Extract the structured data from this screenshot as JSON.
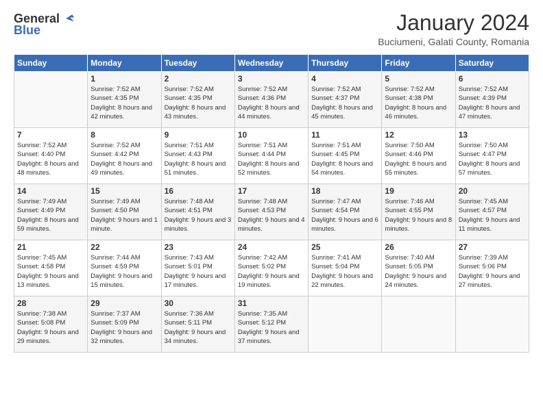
{
  "header": {
    "logo_general": "General",
    "logo_blue": "Blue",
    "month": "January 2024",
    "location": "Buciumeni, Galati County, Romania"
  },
  "weekdays": [
    "Sunday",
    "Monday",
    "Tuesday",
    "Wednesday",
    "Thursday",
    "Friday",
    "Saturday"
  ],
  "weeks": [
    [
      {
        "day": "",
        "sunrise": "",
        "sunset": "",
        "daylight": ""
      },
      {
        "day": "1",
        "sunrise": "Sunrise: 7:52 AM",
        "sunset": "Sunset: 4:35 PM",
        "daylight": "Daylight: 8 hours and 42 minutes."
      },
      {
        "day": "2",
        "sunrise": "Sunrise: 7:52 AM",
        "sunset": "Sunset: 4:35 PM",
        "daylight": "Daylight: 8 hours and 43 minutes."
      },
      {
        "day": "3",
        "sunrise": "Sunrise: 7:52 AM",
        "sunset": "Sunset: 4:36 PM",
        "daylight": "Daylight: 8 hours and 44 minutes."
      },
      {
        "day": "4",
        "sunrise": "Sunrise: 7:52 AM",
        "sunset": "Sunset: 4:37 PM",
        "daylight": "Daylight: 8 hours and 45 minutes."
      },
      {
        "day": "5",
        "sunrise": "Sunrise: 7:52 AM",
        "sunset": "Sunset: 4:38 PM",
        "daylight": "Daylight: 8 hours and 46 minutes."
      },
      {
        "day": "6",
        "sunrise": "Sunrise: 7:52 AM",
        "sunset": "Sunset: 4:39 PM",
        "daylight": "Daylight: 8 hours and 47 minutes."
      }
    ],
    [
      {
        "day": "7",
        "sunrise": "Sunrise: 7:52 AM",
        "sunset": "Sunset: 4:40 PM",
        "daylight": "Daylight: 8 hours and 48 minutes."
      },
      {
        "day": "8",
        "sunrise": "Sunrise: 7:52 AM",
        "sunset": "Sunset: 4:42 PM",
        "daylight": "Daylight: 8 hours and 49 minutes."
      },
      {
        "day": "9",
        "sunrise": "Sunrise: 7:51 AM",
        "sunset": "Sunset: 4:43 PM",
        "daylight": "Daylight: 8 hours and 51 minutes."
      },
      {
        "day": "10",
        "sunrise": "Sunrise: 7:51 AM",
        "sunset": "Sunset: 4:44 PM",
        "daylight": "Daylight: 8 hours and 52 minutes."
      },
      {
        "day": "11",
        "sunrise": "Sunrise: 7:51 AM",
        "sunset": "Sunset: 4:45 PM",
        "daylight": "Daylight: 8 hours and 54 minutes."
      },
      {
        "day": "12",
        "sunrise": "Sunrise: 7:50 AM",
        "sunset": "Sunset: 4:46 PM",
        "daylight": "Daylight: 8 hours and 55 minutes."
      },
      {
        "day": "13",
        "sunrise": "Sunrise: 7:50 AM",
        "sunset": "Sunset: 4:47 PM",
        "daylight": "Daylight: 8 hours and 57 minutes."
      }
    ],
    [
      {
        "day": "14",
        "sunrise": "Sunrise: 7:49 AM",
        "sunset": "Sunset: 4:49 PM",
        "daylight": "Daylight: 8 hours and 59 minutes."
      },
      {
        "day": "15",
        "sunrise": "Sunrise: 7:49 AM",
        "sunset": "Sunset: 4:50 PM",
        "daylight": "Daylight: 9 hours and 1 minute."
      },
      {
        "day": "16",
        "sunrise": "Sunrise: 7:48 AM",
        "sunset": "Sunset: 4:51 PM",
        "daylight": "Daylight: 9 hours and 3 minutes."
      },
      {
        "day": "17",
        "sunrise": "Sunrise: 7:48 AM",
        "sunset": "Sunset: 4:53 PM",
        "daylight": "Daylight: 9 hours and 4 minutes."
      },
      {
        "day": "18",
        "sunrise": "Sunrise: 7:47 AM",
        "sunset": "Sunset: 4:54 PM",
        "daylight": "Daylight: 9 hours and 6 minutes."
      },
      {
        "day": "19",
        "sunrise": "Sunrise: 7:46 AM",
        "sunset": "Sunset: 4:55 PM",
        "daylight": "Daylight: 9 hours and 8 minutes."
      },
      {
        "day": "20",
        "sunrise": "Sunrise: 7:45 AM",
        "sunset": "Sunset: 4:57 PM",
        "daylight": "Daylight: 9 hours and 11 minutes."
      }
    ],
    [
      {
        "day": "21",
        "sunrise": "Sunrise: 7:45 AM",
        "sunset": "Sunset: 4:58 PM",
        "daylight": "Daylight: 9 hours and 13 minutes."
      },
      {
        "day": "22",
        "sunrise": "Sunrise: 7:44 AM",
        "sunset": "Sunset: 4:59 PM",
        "daylight": "Daylight: 9 hours and 15 minutes."
      },
      {
        "day": "23",
        "sunrise": "Sunrise: 7:43 AM",
        "sunset": "Sunset: 5:01 PM",
        "daylight": "Daylight: 9 hours and 17 minutes."
      },
      {
        "day": "24",
        "sunrise": "Sunrise: 7:42 AM",
        "sunset": "Sunset: 5:02 PM",
        "daylight": "Daylight: 9 hours and 19 minutes."
      },
      {
        "day": "25",
        "sunrise": "Sunrise: 7:41 AM",
        "sunset": "Sunset: 5:04 PM",
        "daylight": "Daylight: 9 hours and 22 minutes."
      },
      {
        "day": "26",
        "sunrise": "Sunrise: 7:40 AM",
        "sunset": "Sunset: 5:05 PM",
        "daylight": "Daylight: 9 hours and 24 minutes."
      },
      {
        "day": "27",
        "sunrise": "Sunrise: 7:39 AM",
        "sunset": "Sunset: 5:06 PM",
        "daylight": "Daylight: 9 hours and 27 minutes."
      }
    ],
    [
      {
        "day": "28",
        "sunrise": "Sunrise: 7:38 AM",
        "sunset": "Sunset: 5:08 PM",
        "daylight": "Daylight: 9 hours and 29 minutes."
      },
      {
        "day": "29",
        "sunrise": "Sunrise: 7:37 AM",
        "sunset": "Sunset: 5:09 PM",
        "daylight": "Daylight: 9 hours and 32 minutes."
      },
      {
        "day": "30",
        "sunrise": "Sunrise: 7:36 AM",
        "sunset": "Sunset: 5:11 PM",
        "daylight": "Daylight: 9 hours and 34 minutes."
      },
      {
        "day": "31",
        "sunrise": "Sunrise: 7:35 AM",
        "sunset": "Sunset: 5:12 PM",
        "daylight": "Daylight: 9 hours and 37 minutes."
      },
      {
        "day": "",
        "sunrise": "",
        "sunset": "",
        "daylight": ""
      },
      {
        "day": "",
        "sunrise": "",
        "sunset": "",
        "daylight": ""
      },
      {
        "day": "",
        "sunrise": "",
        "sunset": "",
        "daylight": ""
      }
    ]
  ]
}
